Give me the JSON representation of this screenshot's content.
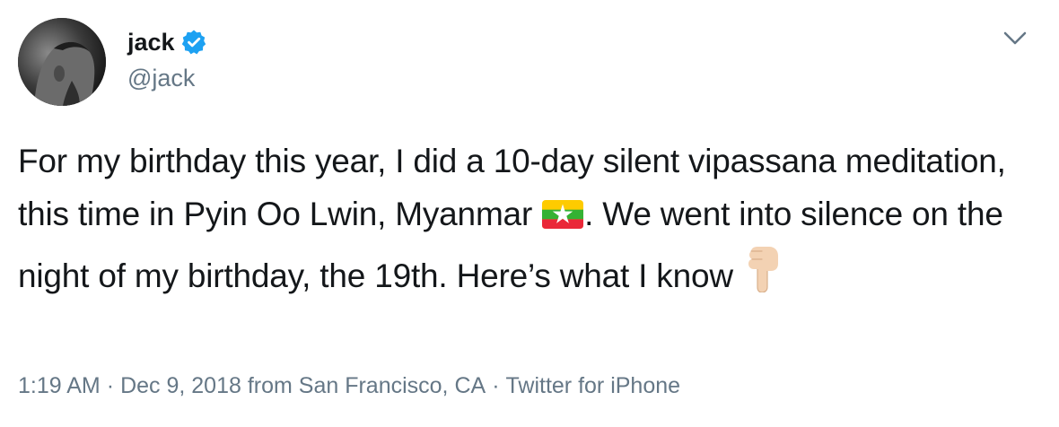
{
  "user": {
    "display_name": "jack",
    "handle": "@jack",
    "verified": true
  },
  "tweet": {
    "text_parts": [
      "For my birthday this year, I did a 10-day silent vipassana meditation, this time in Pyin Oo Lwin, Myanmar ",
      ". We went into silence on the night of my birthday, the 19th. Here’s what I know "
    ],
    "emojis": [
      "myanmar-flag",
      "pointing-down-hand"
    ]
  },
  "meta": {
    "time": "1:19 AM",
    "separator": "·",
    "date_location": "Dec 9, 2018 from San Francisco, CA",
    "source": "Twitter for iPhone"
  },
  "colors": {
    "text": "#14171a",
    "secondary": "#657786",
    "verified_blue": "#1da1f2"
  }
}
